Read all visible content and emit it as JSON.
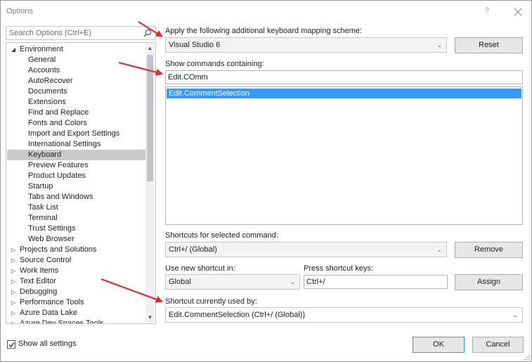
{
  "window": {
    "title": "Options",
    "help_glyph": "?"
  },
  "search": {
    "placeholder": "Search Options (Ctrl+E)"
  },
  "tree": {
    "items": [
      {
        "label": "Environment",
        "kind": "parent-expanded"
      },
      {
        "label": "General",
        "kind": "child"
      },
      {
        "label": "Accounts",
        "kind": "child"
      },
      {
        "label": "AutoRecover",
        "kind": "child"
      },
      {
        "label": "Documents",
        "kind": "child"
      },
      {
        "label": "Extensions",
        "kind": "child"
      },
      {
        "label": "Find and Replace",
        "kind": "child"
      },
      {
        "label": "Fonts and Colors",
        "kind": "child"
      },
      {
        "label": "Import and Export Settings",
        "kind": "child"
      },
      {
        "label": "International Settings",
        "kind": "child"
      },
      {
        "label": "Keyboard",
        "kind": "child",
        "selected": true
      },
      {
        "label": "Preview Features",
        "kind": "child"
      },
      {
        "label": "Product Updates",
        "kind": "child"
      },
      {
        "label": "Startup",
        "kind": "child"
      },
      {
        "label": "Tabs and Windows",
        "kind": "child"
      },
      {
        "label": "Task List",
        "kind": "child"
      },
      {
        "label": "Terminal",
        "kind": "child"
      },
      {
        "label": "Trust Settings",
        "kind": "child"
      },
      {
        "label": "Web Browser",
        "kind": "child"
      },
      {
        "label": "Projects and Solutions",
        "kind": "parent"
      },
      {
        "label": "Source Control",
        "kind": "parent"
      },
      {
        "label": "Work Items",
        "kind": "parent"
      },
      {
        "label": "Text Editor",
        "kind": "parent"
      },
      {
        "label": "Debugging",
        "kind": "parent"
      },
      {
        "label": "Performance Tools",
        "kind": "parent"
      },
      {
        "label": "Azure Data Lake",
        "kind": "parent"
      },
      {
        "label": "Azure Dev Spaces Tools",
        "kind": "parent"
      }
    ]
  },
  "mapping": {
    "label": "Apply the following additional keyboard mapping scheme:",
    "value": "Visual Studio 6",
    "reset_label": "Reset"
  },
  "commands": {
    "label": "Show commands containing:",
    "filter_value": "Edit.COmm",
    "items": [
      "Edit.CommentSelection"
    ]
  },
  "shortcuts": {
    "label": "Shortcuts for selected command:",
    "value": "Ctrl+/ (Global)",
    "remove_label": "Remove"
  },
  "new_shortcut": {
    "scope_label": "Use new shortcut in:",
    "scope_value": "Global",
    "keys_label": "Press shortcut keys:",
    "keys_value": "Ctrl+/",
    "assign_label": "Assign"
  },
  "used_by": {
    "label": "Shortcut currently used by:",
    "value": "Edit.CommentSelection (Ctrl+/ (Global))"
  },
  "footer": {
    "show_all_label": "Show all settings",
    "show_all_checked": true,
    "ok_label": "OK",
    "cancel_label": "Cancel"
  },
  "colors": {
    "selection": "#3399ff",
    "tree_selected": "#c9c9c9",
    "arrow": "#e8232a"
  }
}
